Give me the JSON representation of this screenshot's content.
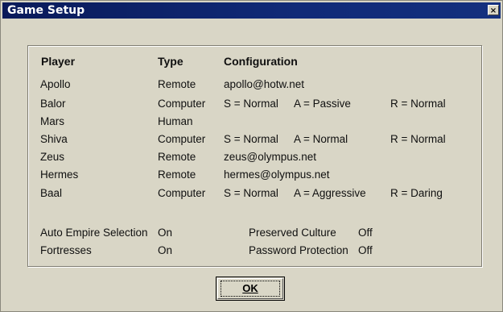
{
  "window": {
    "title": "Game Setup",
    "close_glyph": "×"
  },
  "table": {
    "headers": {
      "player": "Player",
      "type": "Type",
      "configuration": "Configuration"
    },
    "rows": [
      {
        "player": "Apollo",
        "type": "Remote",
        "config": [
          "apollo@hotw.net",
          "",
          ""
        ]
      },
      {
        "player": "Balor",
        "type": "Computer",
        "config": [
          "S = Normal",
          "A = Passive",
          "R = Normal"
        ]
      },
      {
        "player": "Mars",
        "type": "Human",
        "config": [
          "",
          "",
          ""
        ]
      },
      {
        "player": "Shiva",
        "type": "Computer",
        "config": [
          "S = Normal",
          "A = Normal",
          "R = Normal"
        ]
      },
      {
        "player": "Zeus",
        "type": "Remote",
        "config": [
          "zeus@olympus.net",
          "",
          ""
        ]
      },
      {
        "player": "Hermes",
        "type": "Remote",
        "config": [
          "hermes@olympus.net",
          "",
          ""
        ]
      },
      {
        "player": "Baal",
        "type": "Computer",
        "config": [
          "S = Normal",
          "A = Aggressive",
          "R = Daring"
        ]
      }
    ]
  },
  "options": {
    "auto_empire_selection": {
      "label": "Auto Empire Selection",
      "value": "On"
    },
    "fortresses": {
      "label": "Fortresses",
      "value": "On"
    },
    "preserved_culture": {
      "label": "Preserved Culture",
      "value": "Off"
    },
    "password_protection": {
      "label": "Password Protection",
      "value": "Off"
    }
  },
  "buttons": {
    "ok_label": "OK"
  }
}
